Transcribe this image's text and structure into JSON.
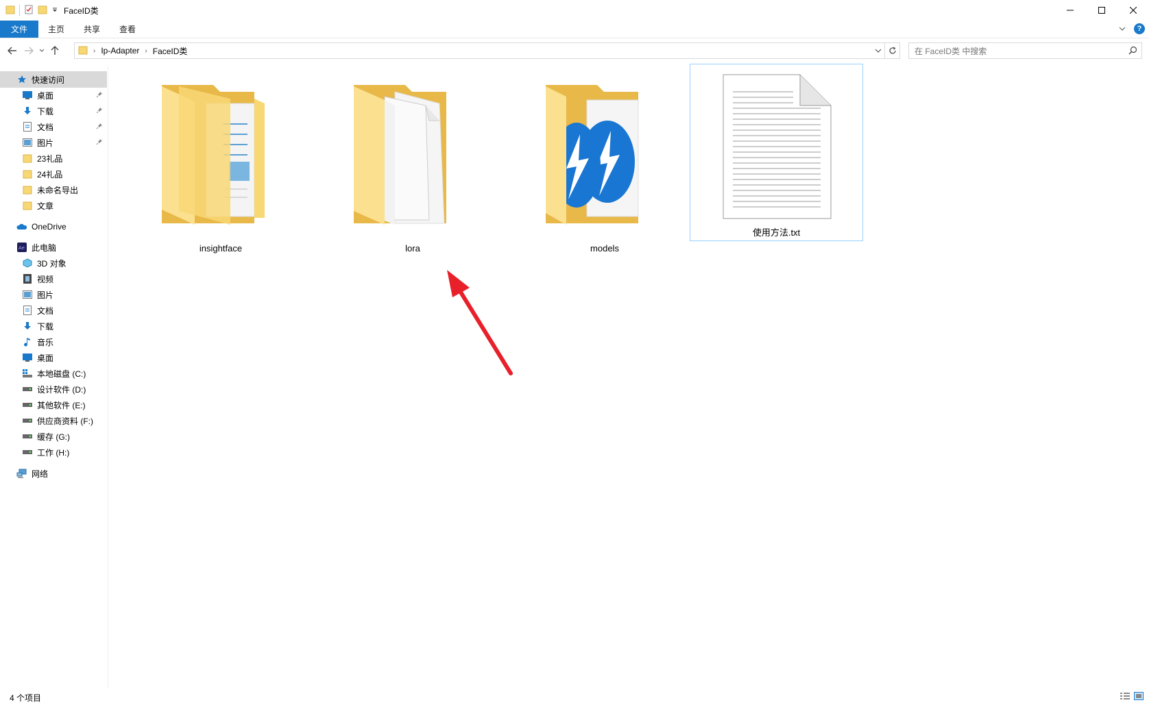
{
  "window": {
    "title": "FaceID类"
  },
  "ribbon": {
    "tabs": [
      "文件",
      "主页",
      "共享",
      "查看"
    ]
  },
  "address": {
    "crumbs": [
      "Ip-Adapter",
      "FaceID类"
    ],
    "search_placeholder": "在 FaceID类 中搜索"
  },
  "sidebar": {
    "quick_access": "快速访问",
    "quick_items": [
      {
        "label": "桌面",
        "icon": "desktop-icon",
        "pinned": true
      },
      {
        "label": "下载",
        "icon": "download-icon",
        "pinned": true
      },
      {
        "label": "文档",
        "icon": "document-icon",
        "pinned": true
      },
      {
        "label": "图片",
        "icon": "pictures-icon",
        "pinned": true
      },
      {
        "label": "23礼品",
        "icon": "folder-icon",
        "pinned": false
      },
      {
        "label": "24礼品",
        "icon": "folder-icon",
        "pinned": false
      },
      {
        "label": "未命名导出",
        "icon": "folder-icon",
        "pinned": false
      },
      {
        "label": "文章",
        "icon": "folder-icon",
        "pinned": false
      }
    ],
    "onedrive": "OneDrive",
    "this_pc": "此电脑",
    "pc_items": [
      {
        "label": "3D 对象",
        "icon": "3d-objects-icon"
      },
      {
        "label": "视频",
        "icon": "video-icon"
      },
      {
        "label": "图片",
        "icon": "pictures-icon"
      },
      {
        "label": "文档",
        "icon": "document-icon"
      },
      {
        "label": "下载",
        "icon": "download-icon"
      },
      {
        "label": "音乐",
        "icon": "music-icon"
      },
      {
        "label": "桌面",
        "icon": "desktop-icon"
      },
      {
        "label": "本地磁盘 (C:)",
        "icon": "system-drive-icon"
      },
      {
        "label": "设计软件 (D:)",
        "icon": "drive-icon"
      },
      {
        "label": "其他软件 (E:)",
        "icon": "drive-icon"
      },
      {
        "label": "供应商资料 (F:)",
        "icon": "drive-icon"
      },
      {
        "label": "缓存 (G:)",
        "icon": "drive-icon"
      },
      {
        "label": "工作 (H:)",
        "icon": "drive-icon"
      }
    ],
    "network": "网络"
  },
  "files": [
    {
      "name": "insightface",
      "type": "folder"
    },
    {
      "name": "lora",
      "type": "folder"
    },
    {
      "name": "models",
      "type": "folder"
    },
    {
      "name": "使用方法.txt",
      "type": "text-file",
      "selected": true
    }
  ],
  "status": {
    "count": "4 个项目"
  },
  "colors": {
    "accent": "#1979ca",
    "folder": "#f8d775",
    "annotation_arrow": "#e8202a"
  }
}
